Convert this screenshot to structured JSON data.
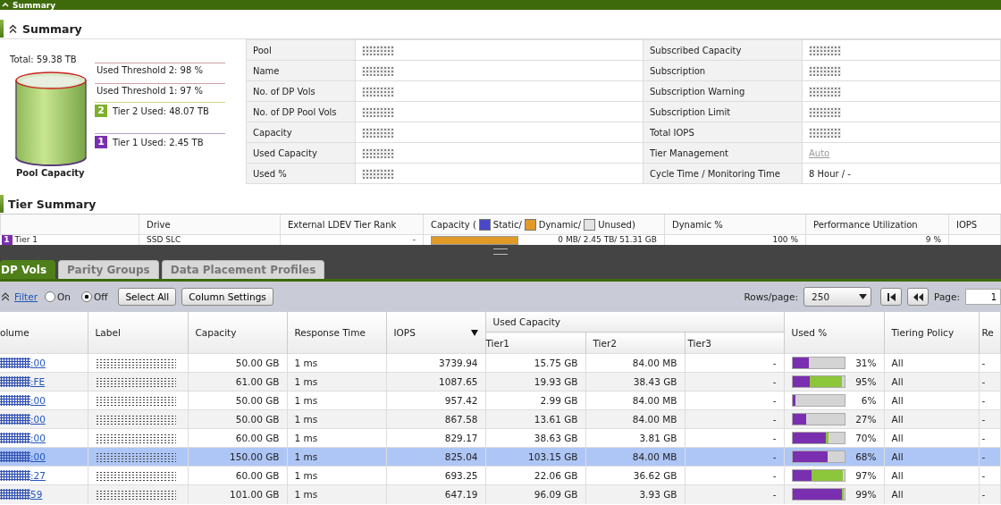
{
  "header": {
    "title": "Summary"
  },
  "summary": {
    "title": "Summary",
    "pool_chart": {
      "total": "Total: 59.38 TB",
      "caption": "Pool Capacity",
      "markers": [
        {
          "kind": "threshold",
          "label": "Used Threshold 2: 98 %"
        },
        {
          "kind": "threshold",
          "label": "Used Threshold 1: 97 %"
        },
        {
          "kind": "tier2",
          "badge": "2",
          "label": "Tier 2 Used: 48.07 TB"
        },
        {
          "kind": "tier1",
          "badge": "1",
          "label": "Tier 1 Used: 2.45 TB"
        }
      ]
    },
    "properties": [
      {
        "label": "Pool",
        "redacted": true
      },
      {
        "label": "Subscribed Capacity",
        "redacted": true
      },
      {
        "label": "Name",
        "redacted": true
      },
      {
        "label": "Subscription",
        "redacted": true
      },
      {
        "label": "No. of DP Vols",
        "redacted": true
      },
      {
        "label": "Subscription Warning",
        "redacted": true
      },
      {
        "label": "No. of DP Pool Vols",
        "redacted": true
      },
      {
        "label": "Subscription Limit",
        "redacted": true
      },
      {
        "label": "Capacity",
        "redacted": true
      },
      {
        "label": "Total IOPS",
        "redacted": true
      },
      {
        "label": "Used Capacity",
        "redacted": true
      },
      {
        "label": "Tier Management",
        "value": "Auto",
        "kind": "link"
      },
      {
        "label": "Used %",
        "redacted": true
      },
      {
        "label": "Cycle Time / Monitoring Time",
        "value": "8 Hour / -",
        "kind": "text"
      }
    ]
  },
  "tier_summary": {
    "title": "Tier Summary",
    "columns": [
      {
        "kind": "text",
        "label": "Drive"
      },
      {
        "kind": "text",
        "label": "External LDEV Tier Rank"
      },
      {
        "kind": "legend",
        "label": "Capacity (",
        "entries": [
          {
            "label": "Static/",
            "color": "#4a48c8"
          },
          {
            "label": "Dynamic/",
            "color": "#e09a28"
          },
          {
            "label": "Unused)",
            "color": "#e4e4e4"
          }
        ]
      },
      {
        "kind": "text",
        "label": "Dynamic %"
      },
      {
        "kind": "text",
        "label": "Performance Utilization"
      },
      {
        "kind": "text",
        "label": "IOPS"
      }
    ],
    "rows": [
      {
        "badge": "1",
        "tier": "Tier 1",
        "drive": "SSD SLC",
        "rank": "-",
        "level": 1,
        "capacity": "0 MB/ 2.45 TB/ 51.31 GB",
        "dynamic": "100 %",
        "performance": "9 %"
      }
    ]
  },
  "tabs": [
    {
      "label": "DP Vols",
      "selected": true
    },
    {
      "label": "Parity Groups",
      "selected": false
    },
    {
      "label": "Data Placement Profiles",
      "selected": false
    }
  ],
  "toolbar": {
    "filter": "Filter",
    "radios": [
      {
        "label": "On",
        "selected": false
      },
      {
        "label": "Off",
        "selected": true
      }
    ],
    "buttons": [
      "Select All",
      "Column Settings"
    ],
    "rows_per_page": {
      "label": "Rows/page:",
      "value": "250"
    },
    "page": {
      "label": "Page:",
      "value": "1"
    }
  },
  "table": {
    "columns": [
      {
        "label": "olume"
      },
      {
        "label": "Label"
      },
      {
        "label": "Capacity"
      },
      {
        "label": "Response Time"
      },
      {
        "label": "IOPS",
        "sorted": true
      }
    ],
    "group": {
      "label": "Used Capacity",
      "columns": [
        "Tier1",
        "Tier2",
        "Tier3"
      ]
    },
    "columns_after": [
      {
        "label": "Used %"
      },
      {
        "label": "Tiering Policy"
      },
      {
        "label": "Re"
      }
    ],
    "rows": [
      {
        "volume": ":00",
        "capacity": "50.00 GB",
        "response": "1 ms",
        "iops": "3739.94",
        "tiers": [
          "15.75 GB",
          "84.00 MB",
          "-"
        ],
        "segments": [
          {
            "kind": "tier1",
            "level": 0.31
          }
        ],
        "used": "31%",
        "policy": "All",
        "re": "-",
        "selected": false
      },
      {
        "volume": ":FE",
        "capacity": "61.00 GB",
        "response": "1 ms",
        "iops": "1087.65",
        "tiers": [
          "19.93 GB",
          "38.43 GB",
          "-"
        ],
        "segments": [
          {
            "kind": "tier1",
            "level": 0.33
          },
          {
            "kind": "tier2",
            "level": 0.62
          }
        ],
        "used": "95%",
        "policy": "All",
        "re": "-",
        "selected": false
      },
      {
        "volume": ":00",
        "capacity": "50.00 GB",
        "response": "1 ms",
        "iops": "957.42",
        "tiers": [
          "2.99 GB",
          "84.00 MB",
          "-"
        ],
        "segments": [
          {
            "kind": "tier1",
            "level": 0.06
          }
        ],
        "used": "6%",
        "policy": "All",
        "re": "-",
        "selected": false
      },
      {
        "volume": ":00",
        "capacity": "50.00 GB",
        "response": "1 ms",
        "iops": "867.58",
        "tiers": [
          "13.61 GB",
          "84.00 MB",
          "-"
        ],
        "segments": [
          {
            "kind": "tier1",
            "level": 0.27
          }
        ],
        "used": "27%",
        "policy": "All",
        "re": "-",
        "selected": false
      },
      {
        "volume": ":00",
        "capacity": "60.00 GB",
        "response": "1 ms",
        "iops": "829.17",
        "tiers": [
          "38.63 GB",
          "3.81 GB",
          "-"
        ],
        "segments": [
          {
            "kind": "tier1",
            "level": 0.64
          },
          {
            "kind": "tier2",
            "level": 0.06
          }
        ],
        "used": "70%",
        "policy": "All",
        "re": "-",
        "selected": false
      },
      {
        "volume": ":00",
        "capacity": "150.00 GB",
        "response": "1 ms",
        "iops": "825.04",
        "tiers": [
          "103.15 GB",
          "84.00 MB",
          "-"
        ],
        "segments": [
          {
            "kind": "tier1",
            "level": 0.68
          }
        ],
        "used": "68%",
        "policy": "All",
        "re": "-",
        "selected": true
      },
      {
        "volume": ":27",
        "capacity": "60.00 GB",
        "response": "1 ms",
        "iops": "693.25",
        "tiers": [
          "22.06 GB",
          "36.62 GB",
          "-"
        ],
        "segments": [
          {
            "kind": "tier1",
            "level": 0.37
          },
          {
            "kind": "tier2",
            "level": 0.6
          }
        ],
        "used": "97%",
        "policy": "All",
        "re": "-",
        "selected": false
      },
      {
        "volume": "59",
        "capacity": "101.00 GB",
        "response": "1 ms",
        "iops": "647.19",
        "tiers": [
          "96.09 GB",
          "3.93 GB",
          "-"
        ],
        "segments": [
          {
            "kind": "tier1",
            "level": 0.95
          },
          {
            "kind": "tier2",
            "level": 0.04
          }
        ],
        "used": "99%",
        "policy": "All",
        "re": "-",
        "selected": false
      }
    ]
  }
}
